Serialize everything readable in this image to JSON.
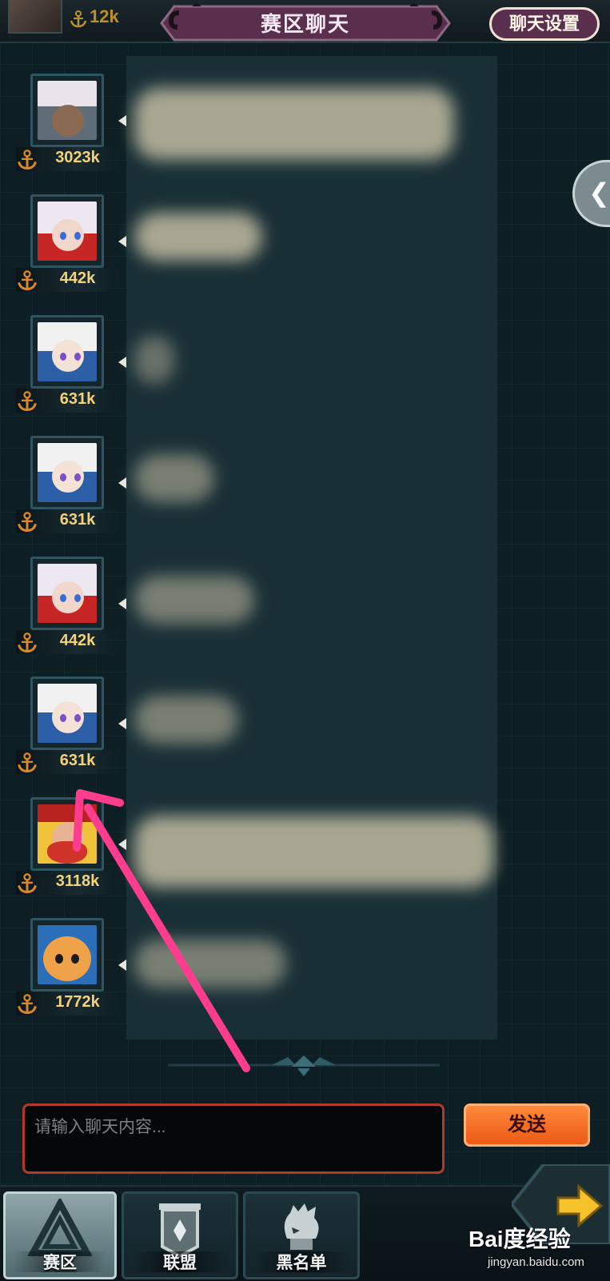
{
  "header": {
    "player_power": "12k",
    "title": "赛区聊天",
    "settings_label": "聊天设置"
  },
  "messages": [
    {
      "power": "3023k",
      "portrait": "scholar",
      "text_visible": false
    },
    {
      "power": "442k",
      "portrait": "white-hair-red-horn",
      "text_visible": false
    },
    {
      "power": "631k",
      "portrait": "blonde-maid",
      "text_visible": false
    },
    {
      "power": "631k",
      "portrait": "blonde-maid",
      "text_visible": false
    },
    {
      "power": "442k",
      "portrait": "white-hair-red-horn",
      "text_visible": false
    },
    {
      "power": "631k",
      "portrait": "blonde-maid",
      "text_visible": false
    },
    {
      "power": "3118k",
      "portrait": "red-bearded-warrior",
      "text_visible": false
    },
    {
      "power": "1772k",
      "portrait": "orange-cat",
      "text_visible": false
    }
  ],
  "input": {
    "placeholder": "请输入聊天内容...",
    "send_label": "发送"
  },
  "tabs": [
    {
      "label": "赛区",
      "icon": "region-triangle-icon",
      "active": true
    },
    {
      "label": "联盟",
      "icon": "alliance-banner-icon",
      "active": false
    },
    {
      "label": "黑名单",
      "icon": "blacklist-head-icon",
      "active": false
    }
  ],
  "watermark": {
    "brand": "Bai度经验",
    "url": "jingyan.baidu.com"
  },
  "colors": {
    "background": "#0d1e24",
    "power_text": "#f2d27a",
    "send_button": "#ec5a16",
    "title_banner": "#5a2f4e",
    "annotation_arrow": "#ff3d8e"
  }
}
